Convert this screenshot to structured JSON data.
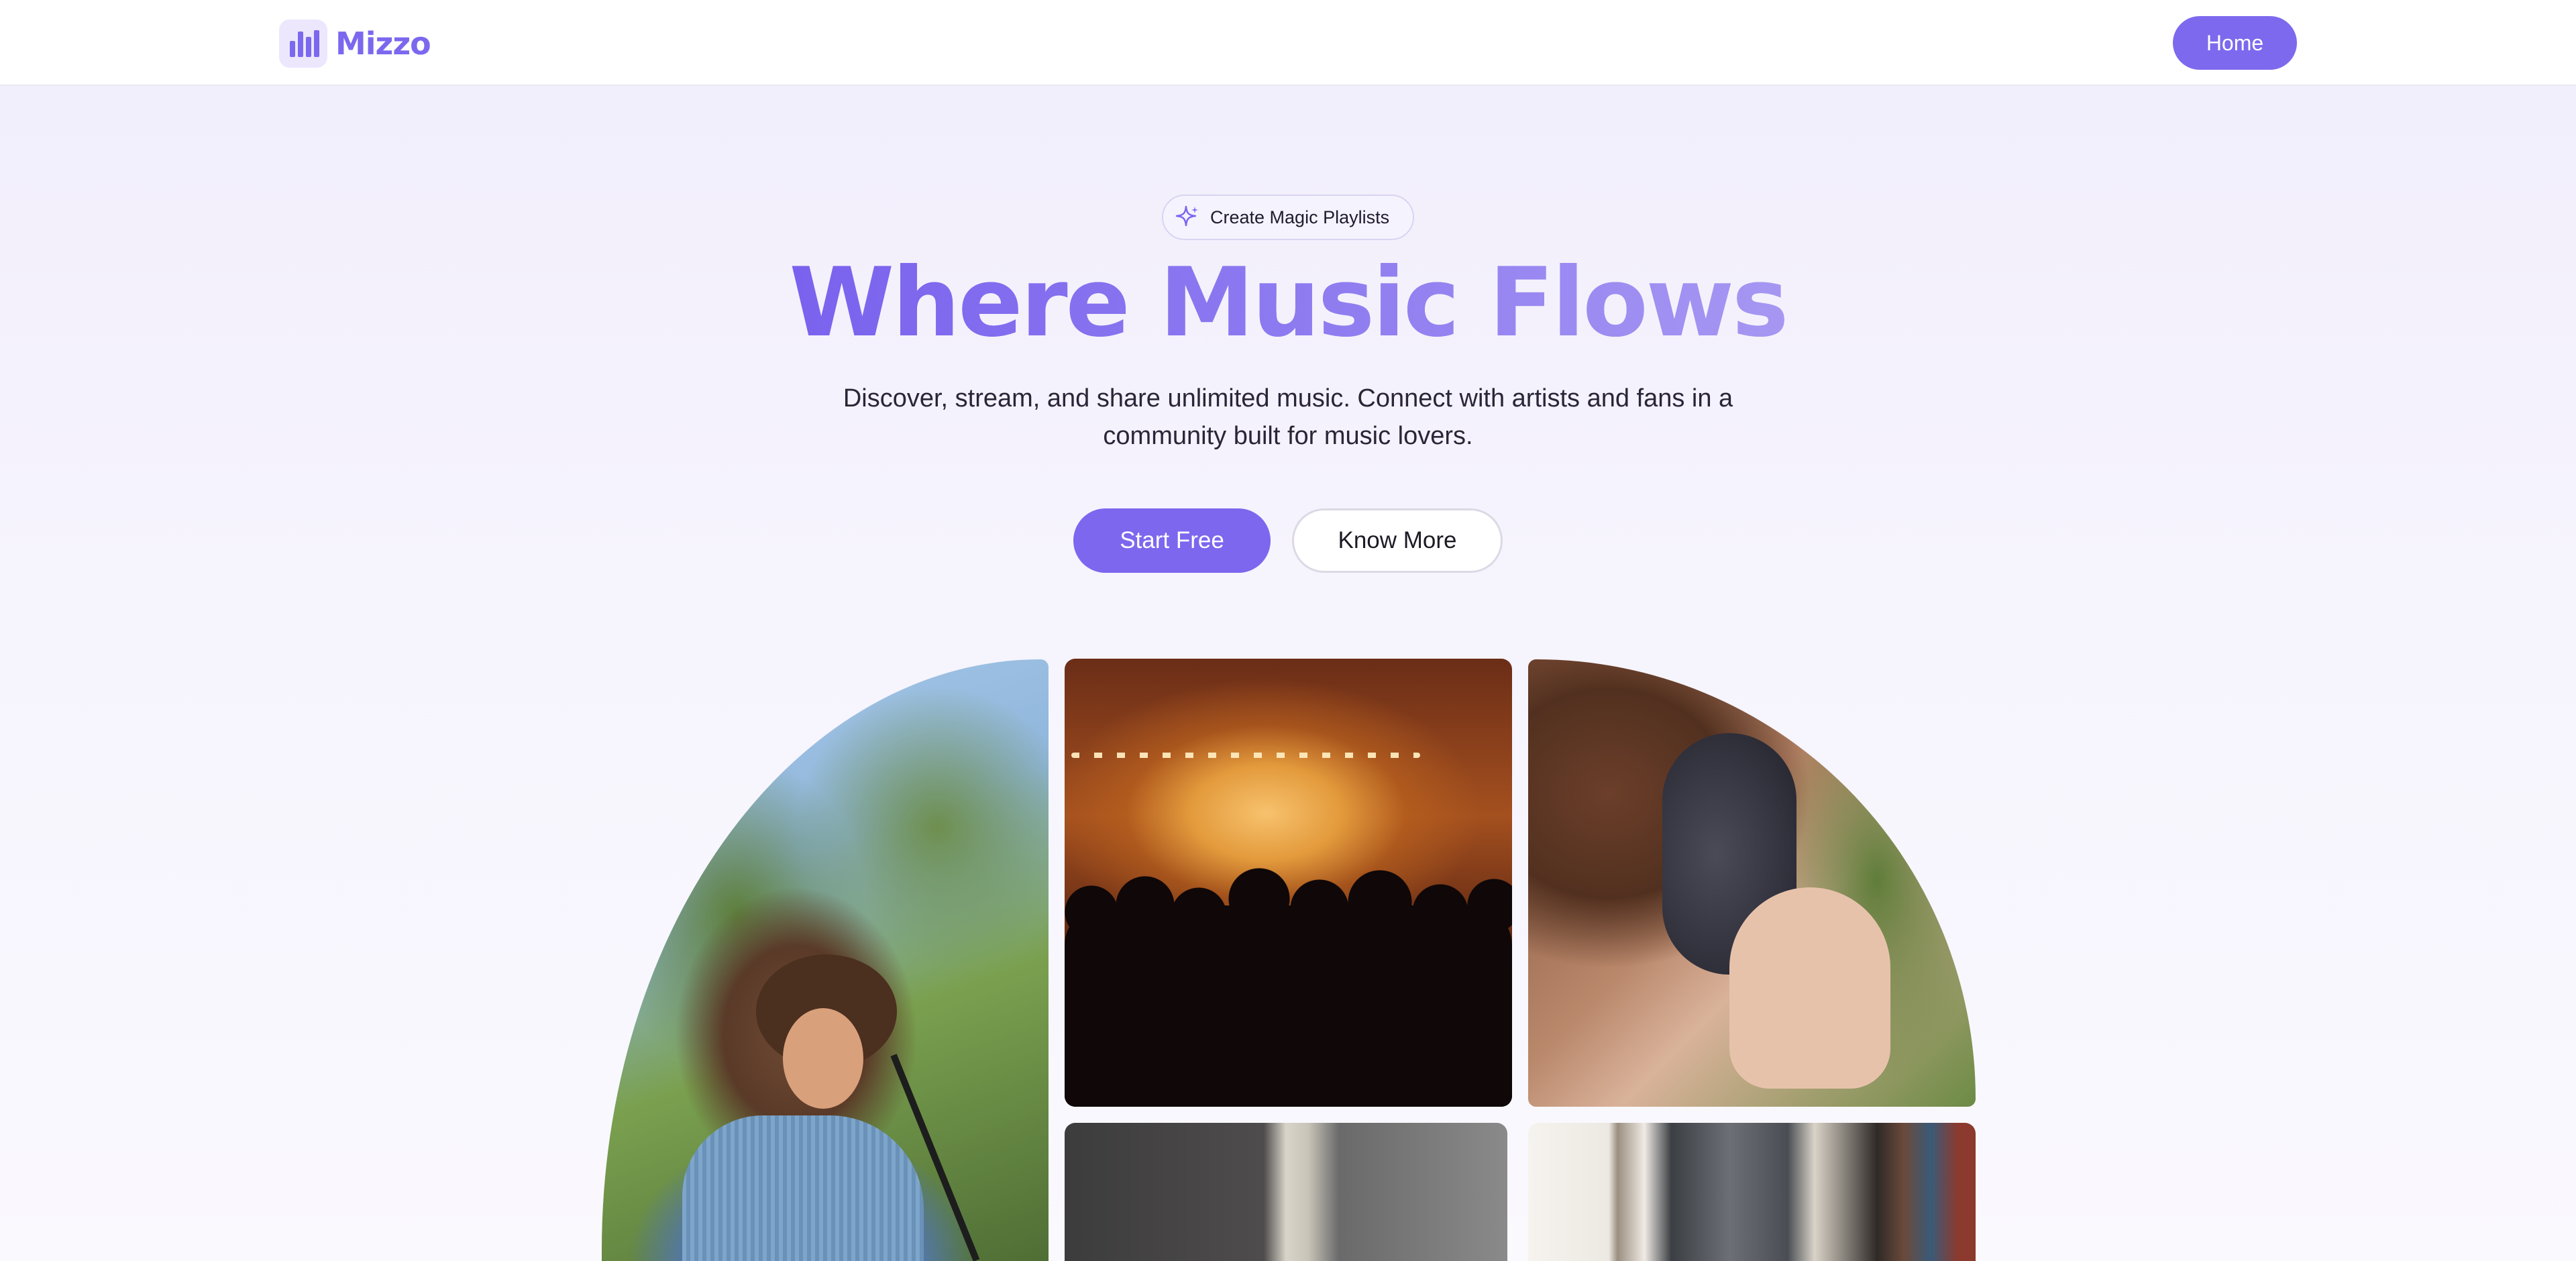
{
  "header": {
    "brand": "Mizzo",
    "nav_home": "Home"
  },
  "hero": {
    "badge": "Create Magic Playlists",
    "title": "Where Music Flows",
    "subtitle": "Discover, stream, and share unlimited music. Connect with artists and fans in a community built for music lovers.",
    "primary_cta": "Start Free",
    "secondary_cta": "Know More"
  },
  "gallery": {
    "images": [
      {
        "name": "singer-with-microphone",
        "description": "Curly-haired singer with sunglasses at a microphone under palm trees"
      },
      {
        "name": "concert-crowd",
        "description": "Concert crowd with raised hands under warm stage lights"
      },
      {
        "name": "person-with-headphones",
        "description": "Person adjusting over-ear headphones"
      },
      {
        "name": "interior-room",
        "description": "Interior room with doorway"
      },
      {
        "name": "window-bookshelf",
        "description": "Window with rainy glass next to a bookshelf"
      }
    ]
  },
  "colors": {
    "accent": "#7c67ee",
    "title_gradient_start": "#7a62ee",
    "title_gradient_end": "#a697f2",
    "text_dark": "#2a2638",
    "background_top": "#f1eefc",
    "background_bottom": "#faf9fe"
  },
  "icons": {
    "logo": "equalizer-bars-icon",
    "badge": "sparkle-icon"
  }
}
